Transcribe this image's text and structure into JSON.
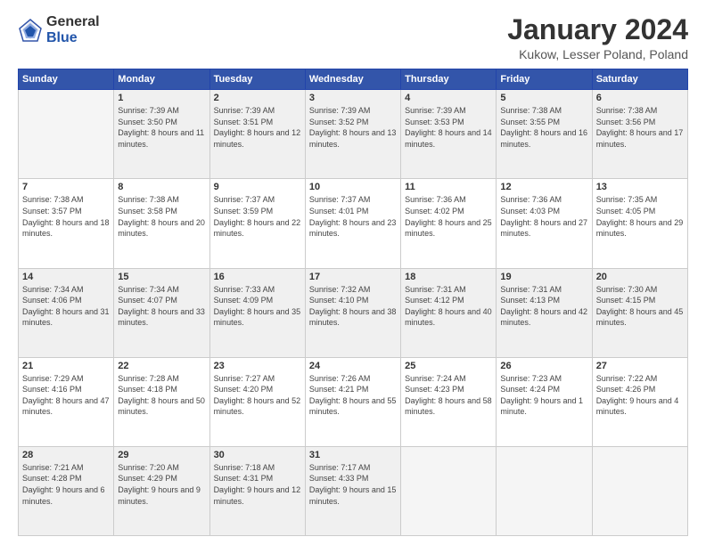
{
  "logo": {
    "general": "General",
    "blue": "Blue"
  },
  "header": {
    "month": "January 2024",
    "location": "Kukow, Lesser Poland, Poland"
  },
  "weekdays": [
    "Sunday",
    "Monday",
    "Tuesday",
    "Wednesday",
    "Thursday",
    "Friday",
    "Saturday"
  ],
  "weeks": [
    [
      {
        "day": "",
        "sunrise": "",
        "sunset": "",
        "daylight": ""
      },
      {
        "day": "1",
        "sunrise": "Sunrise: 7:39 AM",
        "sunset": "Sunset: 3:50 PM",
        "daylight": "Daylight: 8 hours and 11 minutes."
      },
      {
        "day": "2",
        "sunrise": "Sunrise: 7:39 AM",
        "sunset": "Sunset: 3:51 PM",
        "daylight": "Daylight: 8 hours and 12 minutes."
      },
      {
        "day": "3",
        "sunrise": "Sunrise: 7:39 AM",
        "sunset": "Sunset: 3:52 PM",
        "daylight": "Daylight: 8 hours and 13 minutes."
      },
      {
        "day": "4",
        "sunrise": "Sunrise: 7:39 AM",
        "sunset": "Sunset: 3:53 PM",
        "daylight": "Daylight: 8 hours and 14 minutes."
      },
      {
        "day": "5",
        "sunrise": "Sunrise: 7:38 AM",
        "sunset": "Sunset: 3:55 PM",
        "daylight": "Daylight: 8 hours and 16 minutes."
      },
      {
        "day": "6",
        "sunrise": "Sunrise: 7:38 AM",
        "sunset": "Sunset: 3:56 PM",
        "daylight": "Daylight: 8 hours and 17 minutes."
      }
    ],
    [
      {
        "day": "7",
        "sunrise": "Sunrise: 7:38 AM",
        "sunset": "Sunset: 3:57 PM",
        "daylight": "Daylight: 8 hours and 18 minutes."
      },
      {
        "day": "8",
        "sunrise": "Sunrise: 7:38 AM",
        "sunset": "Sunset: 3:58 PM",
        "daylight": "Daylight: 8 hours and 20 minutes."
      },
      {
        "day": "9",
        "sunrise": "Sunrise: 7:37 AM",
        "sunset": "Sunset: 3:59 PM",
        "daylight": "Daylight: 8 hours and 22 minutes."
      },
      {
        "day": "10",
        "sunrise": "Sunrise: 7:37 AM",
        "sunset": "Sunset: 4:01 PM",
        "daylight": "Daylight: 8 hours and 23 minutes."
      },
      {
        "day": "11",
        "sunrise": "Sunrise: 7:36 AM",
        "sunset": "Sunset: 4:02 PM",
        "daylight": "Daylight: 8 hours and 25 minutes."
      },
      {
        "day": "12",
        "sunrise": "Sunrise: 7:36 AM",
        "sunset": "Sunset: 4:03 PM",
        "daylight": "Daylight: 8 hours and 27 minutes."
      },
      {
        "day": "13",
        "sunrise": "Sunrise: 7:35 AM",
        "sunset": "Sunset: 4:05 PM",
        "daylight": "Daylight: 8 hours and 29 minutes."
      }
    ],
    [
      {
        "day": "14",
        "sunrise": "Sunrise: 7:34 AM",
        "sunset": "Sunset: 4:06 PM",
        "daylight": "Daylight: 8 hours and 31 minutes."
      },
      {
        "day": "15",
        "sunrise": "Sunrise: 7:34 AM",
        "sunset": "Sunset: 4:07 PM",
        "daylight": "Daylight: 8 hours and 33 minutes."
      },
      {
        "day": "16",
        "sunrise": "Sunrise: 7:33 AM",
        "sunset": "Sunset: 4:09 PM",
        "daylight": "Daylight: 8 hours and 35 minutes."
      },
      {
        "day": "17",
        "sunrise": "Sunrise: 7:32 AM",
        "sunset": "Sunset: 4:10 PM",
        "daylight": "Daylight: 8 hours and 38 minutes."
      },
      {
        "day": "18",
        "sunrise": "Sunrise: 7:31 AM",
        "sunset": "Sunset: 4:12 PM",
        "daylight": "Daylight: 8 hours and 40 minutes."
      },
      {
        "day": "19",
        "sunrise": "Sunrise: 7:31 AM",
        "sunset": "Sunset: 4:13 PM",
        "daylight": "Daylight: 8 hours and 42 minutes."
      },
      {
        "day": "20",
        "sunrise": "Sunrise: 7:30 AM",
        "sunset": "Sunset: 4:15 PM",
        "daylight": "Daylight: 8 hours and 45 minutes."
      }
    ],
    [
      {
        "day": "21",
        "sunrise": "Sunrise: 7:29 AM",
        "sunset": "Sunset: 4:16 PM",
        "daylight": "Daylight: 8 hours and 47 minutes."
      },
      {
        "day": "22",
        "sunrise": "Sunrise: 7:28 AM",
        "sunset": "Sunset: 4:18 PM",
        "daylight": "Daylight: 8 hours and 50 minutes."
      },
      {
        "day": "23",
        "sunrise": "Sunrise: 7:27 AM",
        "sunset": "Sunset: 4:20 PM",
        "daylight": "Daylight: 8 hours and 52 minutes."
      },
      {
        "day": "24",
        "sunrise": "Sunrise: 7:26 AM",
        "sunset": "Sunset: 4:21 PM",
        "daylight": "Daylight: 8 hours and 55 minutes."
      },
      {
        "day": "25",
        "sunrise": "Sunrise: 7:24 AM",
        "sunset": "Sunset: 4:23 PM",
        "daylight": "Daylight: 8 hours and 58 minutes."
      },
      {
        "day": "26",
        "sunrise": "Sunrise: 7:23 AM",
        "sunset": "Sunset: 4:24 PM",
        "daylight": "Daylight: 9 hours and 1 minute."
      },
      {
        "day": "27",
        "sunrise": "Sunrise: 7:22 AM",
        "sunset": "Sunset: 4:26 PM",
        "daylight": "Daylight: 9 hours and 4 minutes."
      }
    ],
    [
      {
        "day": "28",
        "sunrise": "Sunrise: 7:21 AM",
        "sunset": "Sunset: 4:28 PM",
        "daylight": "Daylight: 9 hours and 6 minutes."
      },
      {
        "day": "29",
        "sunrise": "Sunrise: 7:20 AM",
        "sunset": "Sunset: 4:29 PM",
        "daylight": "Daylight: 9 hours and 9 minutes."
      },
      {
        "day": "30",
        "sunrise": "Sunrise: 7:18 AM",
        "sunset": "Sunset: 4:31 PM",
        "daylight": "Daylight: 9 hours and 12 minutes."
      },
      {
        "day": "31",
        "sunrise": "Sunrise: 7:17 AM",
        "sunset": "Sunset: 4:33 PM",
        "daylight": "Daylight: 9 hours and 15 minutes."
      },
      {
        "day": "",
        "sunrise": "",
        "sunset": "",
        "daylight": ""
      },
      {
        "day": "",
        "sunrise": "",
        "sunset": "",
        "daylight": ""
      },
      {
        "day": "",
        "sunrise": "",
        "sunset": "",
        "daylight": ""
      }
    ]
  ]
}
